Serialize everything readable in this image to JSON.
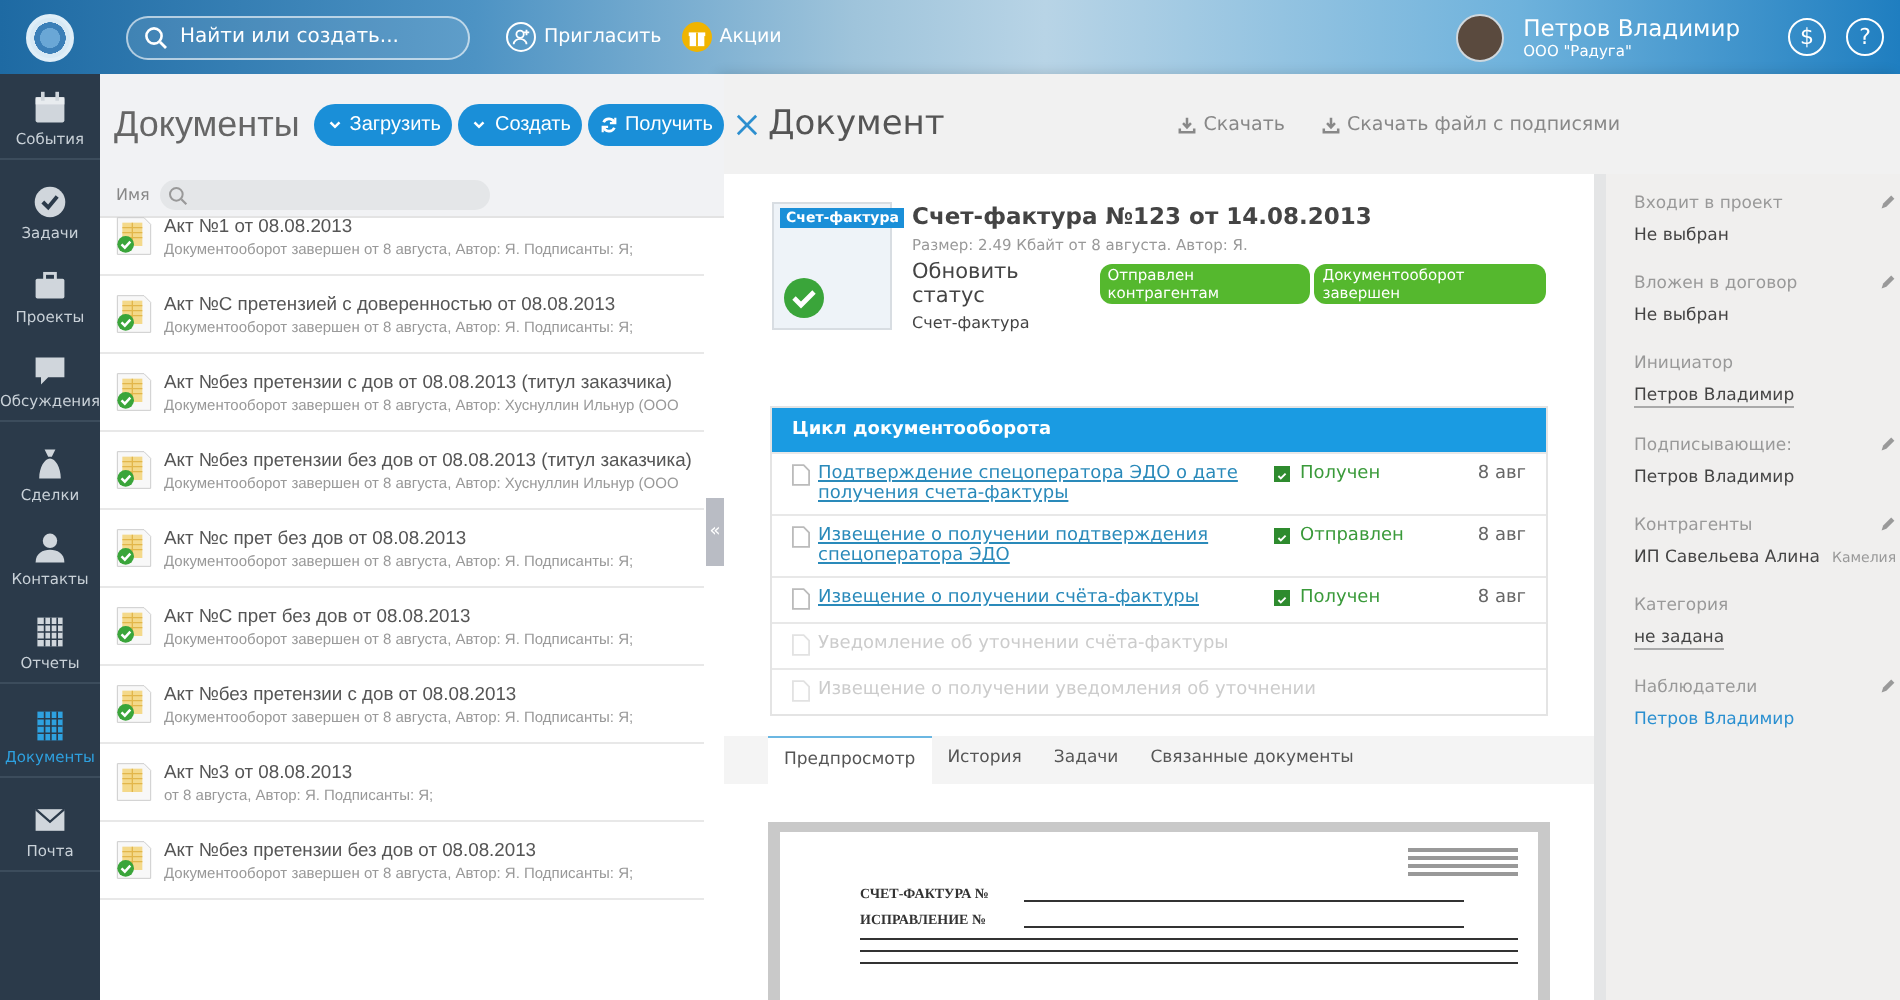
{
  "header": {
    "search": {
      "placeholder": "Найти или создать..."
    },
    "links": [
      {
        "kind": "invite",
        "label": "Пригласить"
      },
      {
        "kind": "promo",
        "label": "Акции"
      }
    ],
    "user": {
      "name": "Петров Владимир",
      "org": "ООО \"Радуга\""
    },
    "round_buttons": [
      "$",
      "?"
    ]
  },
  "sidebar": {
    "items": [
      {
        "kind": "calendar",
        "label": "События",
        "selected": false,
        "group_end": true
      },
      {
        "kind": "check",
        "label": "Задачи",
        "selected": false,
        "group_end": false
      },
      {
        "kind": "case",
        "label": "Проекты",
        "selected": false,
        "group_end": false
      },
      {
        "kind": "chat",
        "label": "Обсуждения",
        "selected": false,
        "group_end": true
      },
      {
        "kind": "bag",
        "label": "Сделки",
        "selected": false,
        "group_end": false
      },
      {
        "kind": "person",
        "label": "Контакты",
        "selected": false,
        "group_end": false
      },
      {
        "kind": "grid",
        "label": "Отчеты",
        "selected": false,
        "group_end": true
      },
      {
        "kind": "grid",
        "label": "Документы",
        "selected": true,
        "group_end": true
      },
      {
        "kind": "mail",
        "label": "Почта",
        "selected": false,
        "group_end": true
      }
    ]
  },
  "documents": {
    "title": "Документы",
    "buttons": [
      {
        "kind": "dropdown",
        "label": "Загрузить"
      },
      {
        "kind": "dropdown",
        "label": "Создать"
      },
      {
        "kind": "refresh",
        "label": "Получить"
      }
    ],
    "filter_label": "Имя",
    "collapse_handle": "«",
    "rows": [
      {
        "title": "Акт №1 от 08.08.2013",
        "subtitle": "Документооборот завершен от 8 августа, Автор: Я. Подписанты: Я;",
        "done": true
      },
      {
        "title": "Акт №С претензией с доверенностью от 08.08.2013",
        "subtitle": "Документооборот завершен от 8 августа, Автор: Я. Подписанты: Я;",
        "done": true
      },
      {
        "title": "Акт №без претензии с дов от 08.08.2013 (титул заказчика)",
        "subtitle": "Документооборот завершен от 8 августа, Автор: Хуснуллин Ильнур (ООО",
        "done": true
      },
      {
        "title": "Акт №без претензии без дов от 08.08.2013 (титул заказчика)",
        "subtitle": "Документооборот завершен от 8 августа, Автор: Хуснуллин Ильнур (ООО",
        "done": true
      },
      {
        "title": "Акт №с прет без дов от 08.08.2013",
        "subtitle": "Документооборот завершен от 8 августа, Автор: Я. Подписанты: Я;",
        "done": true
      },
      {
        "title": "Акт №С прет без дов от 08.08.2013",
        "subtitle": "Документооборот завершен от 8 августа, Автор: Я. Подписанты: Я;",
        "done": true
      },
      {
        "title": "Акт №без претензии с дов от 08.08.2013",
        "subtitle": "Документооборот завершен от 8 августа, Автор: Я. Подписанты: Я;",
        "done": true
      },
      {
        "title": "Акт №3 от 08.08.2013",
        "subtitle": "от 8 августа, Автор: Я. Подписанты: Я;",
        "done": false
      },
      {
        "title": "Акт №без претензии без дов от 08.08.2013",
        "subtitle": "Документооборот завершен от 8 августа, Автор: Я. Подписанты: Я;",
        "done": true
      }
    ]
  },
  "document": {
    "title": "Документ",
    "actions": [
      "Скачать",
      "Скачать файл с подписями"
    ],
    "thumbnail_label": "Счет-фактура",
    "name": "Счет-фактура №123 от 14.08.2013",
    "meta": "Размер: 2.49 Кбайт от 8 августа. Автор: Я.",
    "status_label": "Обновить статус",
    "badges": [
      "Отправлен контрагентам",
      "Документооборот завершен"
    ],
    "type": "Счет-фактура",
    "cycle": {
      "title": "Цикл документооборота",
      "rows": [
        {
          "name": "Подтверждение спецоператора ЭДО о дате получения счета-фактуры",
          "disabled": false,
          "status": "Получен",
          "checked": true,
          "date": "8 авг"
        },
        {
          "name": "Извещение о получении подтверждения спецоператора ЭДО",
          "disabled": false,
          "status": "Отправлен",
          "checked": true,
          "date": "8 авг"
        },
        {
          "name": "Извещение о получении счёта-фактуры",
          "disabled": false,
          "status": "Получен",
          "checked": true,
          "date": "8 авг"
        },
        {
          "name": "Уведомление об уточнении счёта-фактуры",
          "disabled": true
        },
        {
          "name": "Извещение о получении уведомления об уточнении",
          "disabled": true
        }
      ]
    },
    "tabs": [
      {
        "label": "Предпросмотр",
        "selected": true
      },
      {
        "label": "История",
        "selected": false
      },
      {
        "label": "Задачи",
        "selected": false
      },
      {
        "label": "Связанные документы",
        "selected": false
      }
    ],
    "preview": {
      "heading": "СЧЕТ-ФАКТУРА №",
      "correction": "ИСПРАВЛЕНИЕ №"
    }
  },
  "properties": [
    {
      "label": "Входит в проект",
      "value": "Не выбран",
      "kind": "plain",
      "editable": true
    },
    {
      "label": "Вложен в договор",
      "value": "Не выбран",
      "kind": "plain",
      "editable": true
    },
    {
      "label": "Инициатор",
      "value": "Петров Владимир",
      "kind": "underlined",
      "editable": false
    },
    {
      "label": "Подписывающие:",
      "value": "Петров Владимир",
      "kind": "plain",
      "editable": true
    },
    {
      "label": "Контрагенты",
      "value": "ИП Савельева Алина",
      "note": "Камелия",
      "kind": "plain",
      "editable": true
    },
    {
      "label": "Категория",
      "value": "не задана",
      "kind": "underlined",
      "editable": false
    },
    {
      "label": "Наблюдатели",
      "value": "Петров Владимир",
      "kind": "link",
      "editable": true
    }
  ]
}
